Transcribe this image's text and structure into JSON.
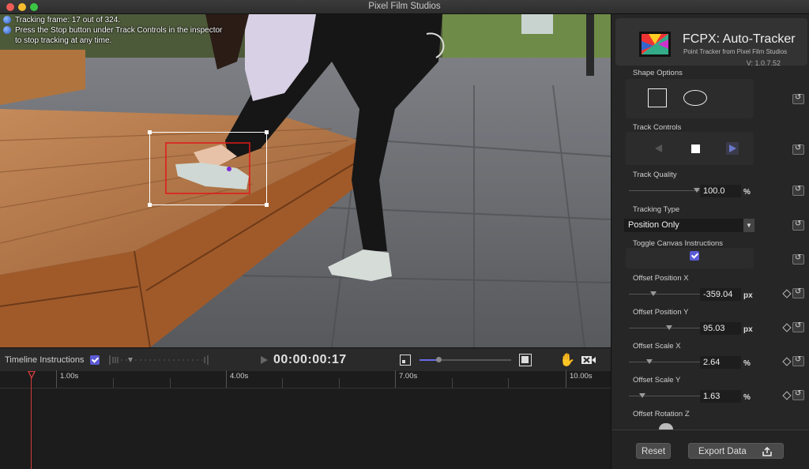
{
  "window": {
    "title": "Pixel Film Studios"
  },
  "viewer": {
    "instructions": [
      "Tracking frame: 17 out of 324.",
      "Press the Stop button under Track Controls in the inspector to stop tracking at any time."
    ]
  },
  "timeline_bar": {
    "label": "Timeline Instructions",
    "timecode": "00:00:00:17"
  },
  "timeline": {
    "labels": [
      "1.00s",
      "4.00s",
      "7.00s",
      "10.00s"
    ]
  },
  "inspector": {
    "plugin_name": "FCPX: Auto-Tracker",
    "plugin_sub": "Point Tracker from Pixel Film Studios",
    "version": "V: 1.0.7.52",
    "shape_options": "Shape Options",
    "track_controls": "Track Controls",
    "track_quality": {
      "label": "Track Quality",
      "value": "100.0",
      "unit": "%"
    },
    "tracking_type": {
      "label": "Tracking Type",
      "value": "Position Only"
    },
    "toggle_canvas": "Toggle Canvas Instructions",
    "offset_x": {
      "label": "Offset Position X",
      "value": "-359.04",
      "unit": "px"
    },
    "offset_y": {
      "label": "Offset Position Y",
      "value": "95.03",
      "unit": "px"
    },
    "scale_x": {
      "label": "Offset Scale X",
      "value": "2.64",
      "unit": "%"
    },
    "scale_y": {
      "label": "Offset Scale Y",
      "value": "1.63",
      "unit": "%"
    },
    "rotation_z": {
      "label": "Offset Rotation Z"
    },
    "reset": "Reset",
    "export": "Export Data"
  }
}
